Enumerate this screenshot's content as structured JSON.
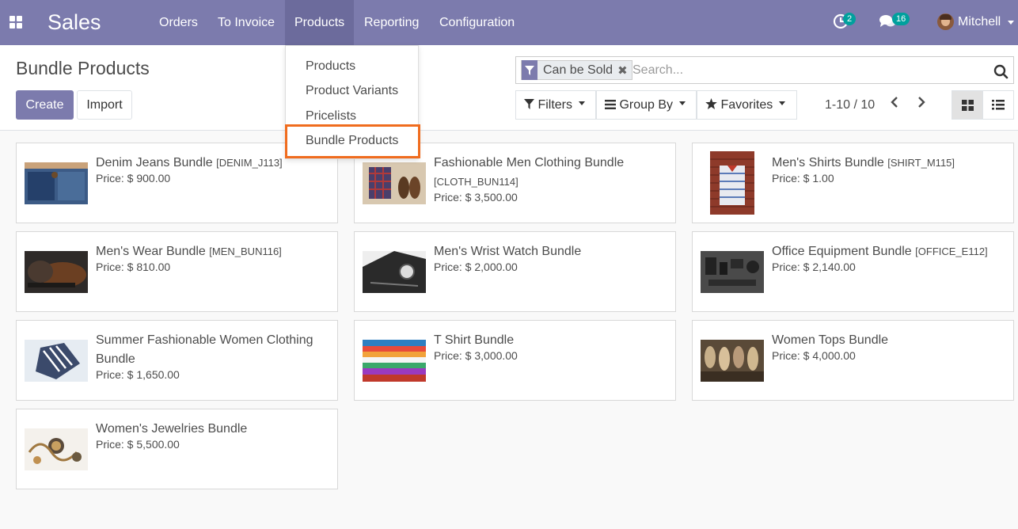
{
  "navbar": {
    "app_title": "Sales",
    "menu": [
      "Orders",
      "To Invoice",
      "Products",
      "Reporting",
      "Configuration"
    ],
    "active_menu": "Products",
    "activity_count": "2",
    "messages_count": "16",
    "user_name": "Mitchell"
  },
  "products_menu": {
    "items": [
      "Products",
      "Product Variants",
      "Pricelists",
      "Bundle Products"
    ],
    "highlighted": "Bundle Products"
  },
  "control_panel": {
    "breadcrumb": "Bundle Products",
    "create_label": "Create",
    "import_label": "Import",
    "facet_label": "Can be Sold",
    "search_placeholder": "Search...",
    "filters_label": "Filters",
    "groupby_label": "Group By",
    "favorites_label": "Favorites",
    "pager": "1-10 / 10",
    "active_view": "kanban"
  },
  "products": [
    {
      "name": "Denim Jeans Bundle",
      "code": "[DENIM_J113]",
      "price": "Price: $ 900.00"
    },
    {
      "name": "Fashionable Men Clothing Bundle",
      "code": "[CLOTH_BUN114]",
      "price": "Price: $ 3,500.00"
    },
    {
      "name": "Men's Shirts Bundle",
      "code": "[SHIRT_M115]",
      "price": "Price: $ 1.00"
    },
    {
      "name": "Men's Wear Bundle",
      "code": "[MEN_BUN116]",
      "price": "Price: $ 810.00"
    },
    {
      "name": "Men's Wrist Watch Bundle",
      "code": "",
      "price": "Price: $ 2,000.00"
    },
    {
      "name": "Office Equipment Bundle",
      "code": "[OFFICE_E112]",
      "price": "Price: $ 2,140.00"
    },
    {
      "name": "Summer Fashionable Women Clothing Bundle",
      "code": "",
      "price": "Price: $ 1,650.00"
    },
    {
      "name": "T Shirt Bundle",
      "code": "",
      "price": "Price: $ 3,000.00"
    },
    {
      "name": "Women Tops Bundle",
      "code": "",
      "price": "Price: $ 4,000.00"
    },
    {
      "name": "Women's Jewelries Bundle",
      "code": "",
      "price": "Price: $ 5,500.00"
    }
  ],
  "colors": {
    "navbar": "#7c7bad",
    "primary_button": "#7c7bad",
    "badge": "#00a09d",
    "highlight": "#f06c1e"
  }
}
